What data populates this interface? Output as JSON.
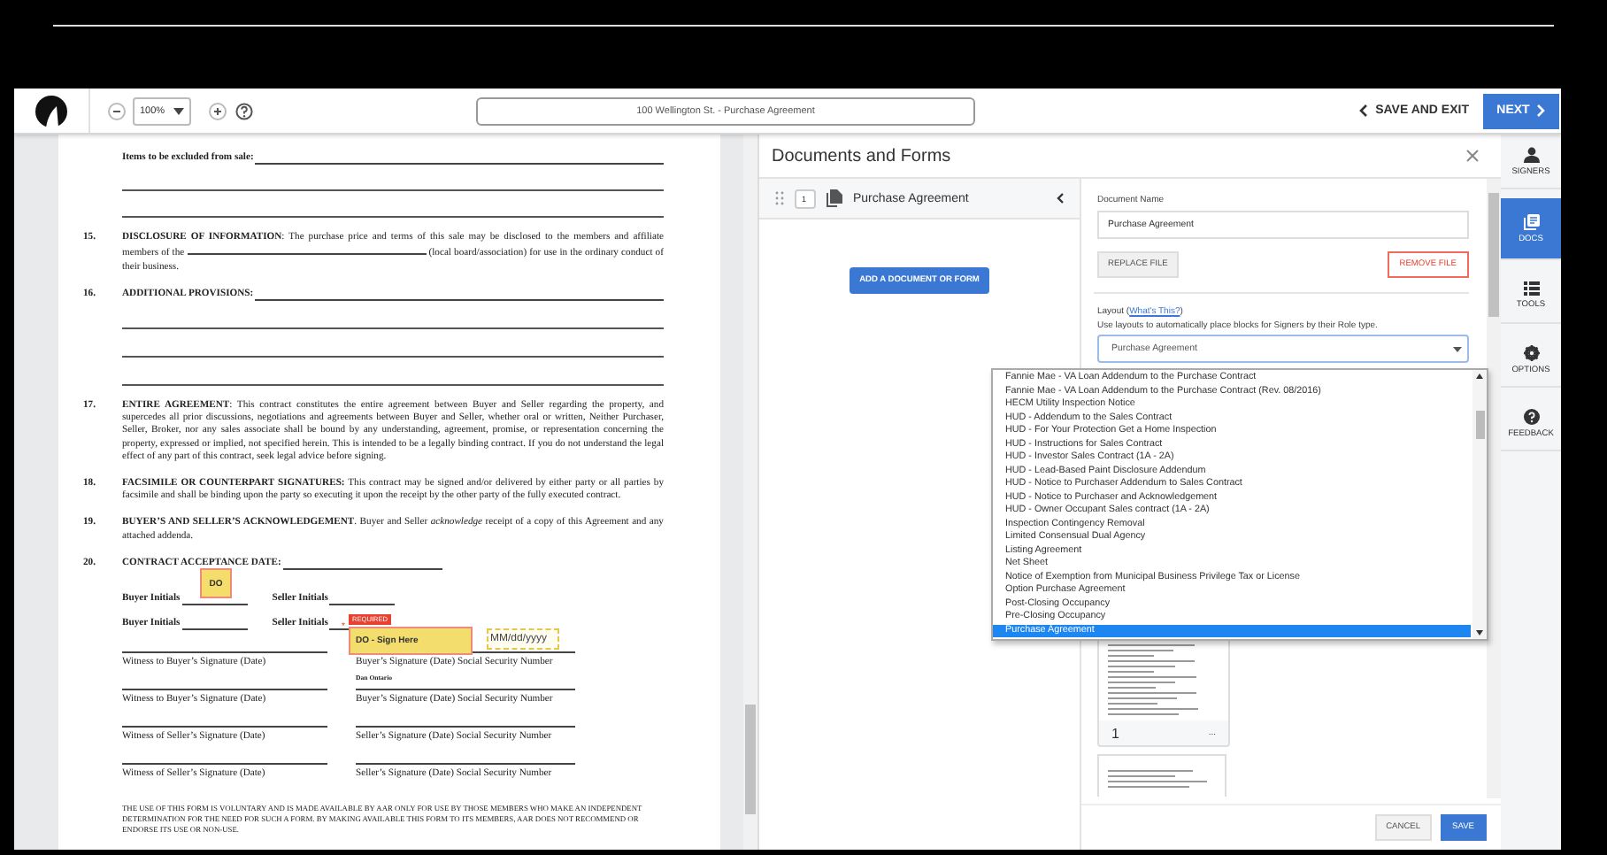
{
  "toolbar": {
    "zoom": "100%",
    "document_title": "100 Wellington St. - Purchase Agreement",
    "save_exit": "SAVE AND EXIT",
    "next": "NEXT"
  },
  "document": {
    "sections": [
      {
        "kind": "label_lines",
        "text": "Items to be excluded from sale:"
      },
      {
        "kind": "blank_paragraph",
        "number": "15.",
        "before": "**DISCLOSURE OF INFORMATION**: The purchase price and terms of this sale may be disclosed to the members and affiliate members of the",
        "after": "(local board/association) for use in the ordinary conduct of their business."
      },
      {
        "kind": "heading_lines",
        "number": "16.",
        "text": "ADDITIONAL PROVISIONS:"
      },
      {
        "kind": "paragraph",
        "number": "17.",
        "text": "**ENTIRE AGREEMENT**: This contract constitutes the entire agreement between Buyer and Seller regarding the property, and supercedes all prior discussions, negotiations and agreements between Buyer and Seller, whether oral or written, Neither Purchaser, Seller, Broker, nor any sales associate shall be bound by any understanding, agreement, promise, or representation concerning the property, expressed or implied, not specified herein. This is intended to be a legally binding contract. If you do not understand the legal effect of any part of this contract, seek legal advice before signing."
      },
      {
        "kind": "paragraph",
        "number": "18.",
        "text": "**FACSIMILE OR COUNTERPART SIGNATURES:** This contract may be signed and/or delivered by either party or all parties by facsimile and shall be binding upon the party so executing it upon the receipt by the other party of the fully executed contract."
      },
      {
        "kind": "paragraph",
        "number": "19.",
        "text": "**BUYER’S AND SELLER’S ACKNOWLEDGEMENT**. Buyer and Seller *acknowledge* receipt of a copy of this Agreement and any attached addenda."
      },
      {
        "kind": "heading_blank",
        "number": "20.",
        "text": "CONTRACT ACCEPTANCE DATE:"
      }
    ],
    "initials": [
      {
        "buyer": "Buyer Initials",
        "seller": "Seller Initials"
      },
      {
        "buyer": "Buyer Initials",
        "seller": "Seller Initials"
      }
    ],
    "signatures": [
      {
        "left": "Witness to Buyer’s Signature (Date)",
        "right": "Buyer’s Signature (Date) Social Security Number"
      },
      {
        "left": "Witness to Buyer’s Signature (Date)",
        "right": "Buyer’s Signature (Date) Social Security Number"
      },
      {
        "left": "Witness of Seller’s Signature (Date)",
        "right": "Seller’s Signature (Date) Social Security Number"
      },
      {
        "left": "Witness of Seller’s Signature (Date)",
        "right": "Seller’s Signature (Date) Social Security Number"
      }
    ],
    "footer": "THE USE OF THIS FORM IS VOLUNTARY AND IS MADE AVAILABLE BY AAR ONLY FOR USE BY THOSE MEMBERS WHO MAKE AN INDEPENDENT DETERMINATION FOR THE NEED FOR SUCH A FORM. BY MAKING AVAILABLE THIS FORM TO ITS MEMBERS, AAR DOES NOT RECOMMEND OR ENDORSE ITS USE OR NON-USE.",
    "fields": {
      "initials_tag": "DO",
      "required_tag": "REQUIRED",
      "required_asterisk": "*",
      "sign_here": "DO - Sign Here",
      "date_placeholder": "MM/dd/yyyy",
      "signer_name": "Dan Ontario"
    }
  },
  "panel": {
    "title": "Documents and Forms",
    "documents": [
      {
        "number": "1",
        "name": "Purchase Agreement"
      }
    ],
    "add_button": "ADD A DOCUMENT OR FORM",
    "document_name_label": "Document Name",
    "document_name": "Purchase Agreement",
    "replace_button": "REPLACE FILE",
    "remove_button": "REMOVE FILE",
    "layout_label": "Layout (",
    "layout_link": "What's This?",
    "layout_label_end": ")",
    "layout_hint": "Use layouts to automatically place blocks for Signers by their Role type.",
    "layout_value": "Purchase Agreement",
    "layout_options": [
      {
        "label": "Fannie Mae - VA Loan Addendum to the Purchase Contract",
        "selected": false
      },
      {
        "label": "Fannie Mae - VA Loan Addendum to the Purchase Contract (Rev. 08/2016)",
        "selected": false
      },
      {
        "label": "HECM Utility Inspection Notice",
        "selected": false
      },
      {
        "label": "HUD - Addendum to the Sales Contract",
        "selected": false
      },
      {
        "label": "HUD - For Your Protection Get a Home Inspection",
        "selected": false
      },
      {
        "label": "HUD - Instructions for Sales Contract",
        "selected": false
      },
      {
        "label": "HUD - Investor Sales Contract (1A - 2A)",
        "selected": false
      },
      {
        "label": "HUD - Lead-Based Paint Disclosure Addendum",
        "selected": false
      },
      {
        "label": "HUD - Notice to Purchaser Addendum to Sales Contract",
        "selected": false
      },
      {
        "label": "HUD - Notice to Purchaser and Acknowledgement",
        "selected": false
      },
      {
        "label": "HUD - Owner Occupant Sales contract (1A - 2A)",
        "selected": false
      },
      {
        "label": "Inspection Contingency Removal",
        "selected": false
      },
      {
        "label": "Limited Consensual Dual Agency",
        "selected": false
      },
      {
        "label": "Listing Agreement",
        "selected": false
      },
      {
        "label": "Net Sheet",
        "selected": false
      },
      {
        "label": "Notice of Exemption from Municipal Business Privilege Tax or License",
        "selected": false
      },
      {
        "label": "Option Purchase Agreement",
        "selected": false
      },
      {
        "label": "Post-Closing Occupancy",
        "selected": false
      },
      {
        "label": "Pre-Closing Occupancy",
        "selected": false
      },
      {
        "label": "Purchase Agreement",
        "selected": true
      }
    ],
    "page_number": "1",
    "page_menu": "...",
    "cancel_button": "CANCEL",
    "save_button": "SAVE"
  },
  "sidebar": [
    {
      "kind": "person",
      "label": "SIGNERS",
      "selected": false
    },
    {
      "kind": "docs",
      "label": "DOCS",
      "selected": true
    },
    {
      "kind": "list",
      "label": "TOOLS",
      "selected": false
    },
    {
      "kind": "gear",
      "label": "OPTIONS",
      "selected": false
    },
    {
      "kind": "help",
      "label": "FEEDBACK",
      "selected": false
    }
  ]
}
